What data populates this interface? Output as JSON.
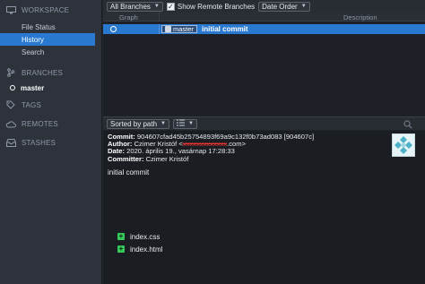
{
  "sidebar": {
    "workspace": {
      "title": "WORKSPACE",
      "items": [
        {
          "label": "File Status"
        },
        {
          "label": "History"
        },
        {
          "label": "Search"
        }
      ]
    },
    "branches": {
      "title": "BRANCHES",
      "items": [
        {
          "label": "master"
        }
      ]
    },
    "tags": {
      "title": "TAGS"
    },
    "remotes": {
      "title": "REMOTES"
    },
    "stashes": {
      "title": "STASHES"
    }
  },
  "toolbar": {
    "branch_filter": "All Branches",
    "show_remote_label": "Show Remote Branches",
    "order_select": "Date Order"
  },
  "columns": {
    "graph": "Graph",
    "description": "Description"
  },
  "commit": {
    "branch_tag": "master",
    "message": "initial commit"
  },
  "bottom": {
    "sort_select": "Sorted by path",
    "view_select": ""
  },
  "details": {
    "commit_label": "Commit:",
    "commit_value": "904607cfad45b25754893f69a9c132f0b73ad083 [904607c]",
    "author_label": "Author:",
    "author_name": "Czimer Kristóf <",
    "author_email_redacted": "xxxxxxxxxxxxx",
    "author_email_tail": ".com>",
    "date_label": "Date:",
    "date_value": "2020. április 19., vasárnap 17:28:33",
    "committer_label": "Committer:",
    "committer_value": "Czimer Kristóf",
    "message": "initial commit"
  },
  "files": [
    {
      "name": "index.css"
    },
    {
      "name": "index.html"
    }
  ],
  "colors": {
    "accent": "#2a79d0",
    "added": "#37c85c"
  }
}
